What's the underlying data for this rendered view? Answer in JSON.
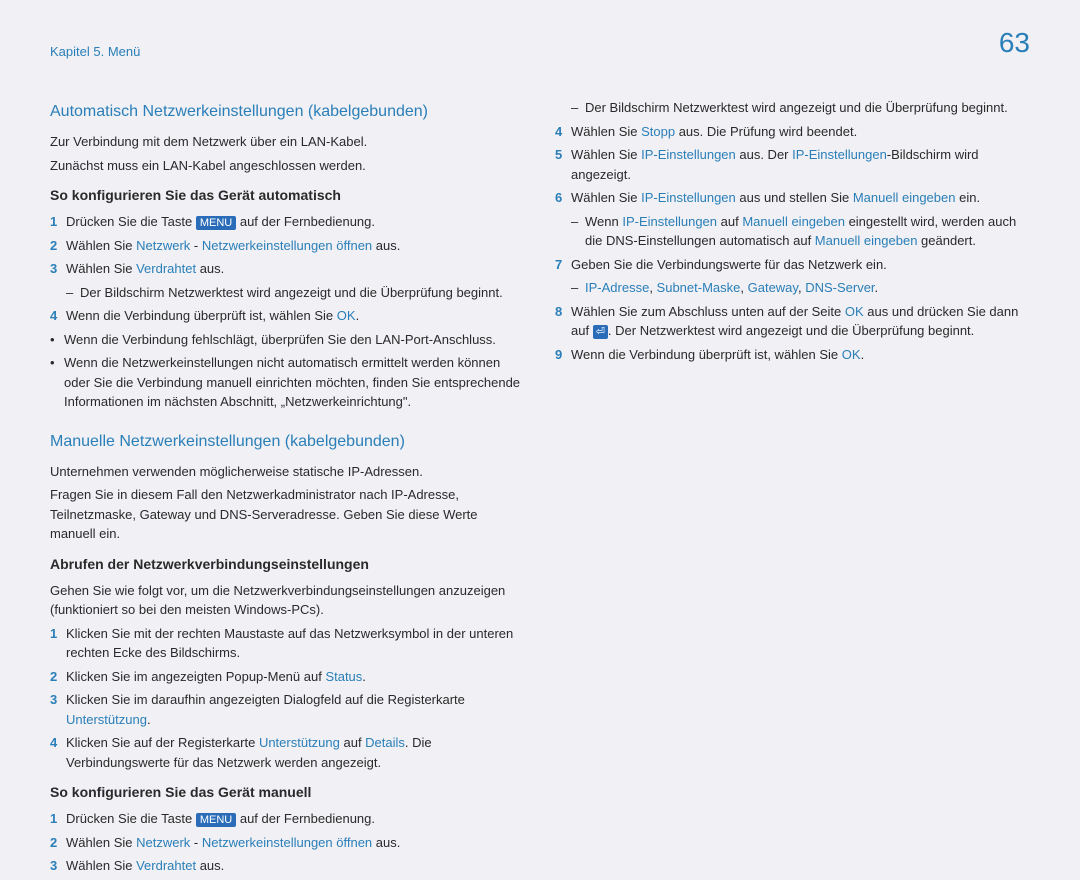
{
  "header": {
    "breadcrumb": "Kapitel 5. Menü",
    "page_number": "63"
  },
  "left": {
    "section1": {
      "title": "Automatisch Netzwerkeinstellungen (kabelgebunden)",
      "p1": "Zur Verbindung mit dem Netzwerk über ein LAN-Kabel.",
      "p2": "Zunächst muss ein LAN-Kabel angeschlossen werden.",
      "sub_title": "So konfigurieren Sie das Gerät automatisch",
      "step1_a": "Drücken Sie die Taste ",
      "step1_menu": "MENU",
      "step1_b": " auf der Fernbedienung.",
      "step2_a": "Wählen Sie ",
      "step2_hl1": "Netzwerk",
      "step2_mid": " - ",
      "step2_hl2": "Netzwerkeinstellungen öffnen",
      "step2_b": " aus.",
      "step3_a": "Wählen Sie ",
      "step3_hl": "Verdrahtet",
      "step3_b": " aus.",
      "step3_sub": "Der Bildschirm Netzwerktest wird angezeigt und die Überprüfung beginnt.",
      "step4_a": "Wenn die Verbindung überprüft ist, wählen Sie ",
      "step4_hl": "OK",
      "step4_b": ".",
      "bullet1": "Wenn die Verbindung fehlschlägt, überprüfen Sie den LAN-Port-Anschluss.",
      "bullet2": "Wenn die Netzwerkeinstellungen nicht automatisch ermittelt werden können oder Sie die Verbindung manuell einrichten möchten, finden Sie entsprechende Informationen im nächsten Abschnitt, „Netzwerkeinrichtung\"."
    },
    "section2": {
      "title": "Manuelle Netzwerkeinstellungen (kabelgebunden)",
      "p1": "Unternehmen verwenden möglicherweise statische IP-Adressen.",
      "p2": "Fragen Sie in diesem Fall den Netzwerkadministrator nach IP-Adresse, Teilnetzmaske, Gateway und DNS-Serveradresse. Geben Sie diese Werte manuell ein.",
      "sub_title1": "Abrufen der Netzwerkverbindungseinstellungen",
      "p3": "Gehen Sie wie folgt vor, um die Netzwerkverbindungseinstellungen anzuzeigen (funktioniert so bei den meisten Windows-PCs).",
      "a_step1": "Klicken Sie mit der rechten Maustaste auf das Netzwerksymbol in der unteren rechten Ecke des Bildschirms.",
      "a_step2_a": "Klicken Sie im angezeigten Popup-Menü auf ",
      "a_step2_hl": "Status",
      "a_step2_b": ".",
      "a_step3_a": "Klicken Sie im daraufhin angezeigten Dialogfeld auf die Registerkarte ",
      "a_step3_hl": "Unterstützung",
      "a_step3_b": ".",
      "a_step4_a": "Klicken Sie auf der Registerkarte ",
      "a_step4_hl1": "Unterstützung",
      "a_step4_mid": " auf ",
      "a_step4_hl2": "Details",
      "a_step4_b": ". Die Verbindungswerte für das Netzwerk werden angezeigt.",
      "sub_title2": "So konfigurieren Sie das Gerät manuell",
      "b_step1_a": "Drücken Sie die Taste ",
      "b_step1_menu": "MENU",
      "b_step1_b": " auf der Fernbedienung.",
      "b_step2_a": "Wählen Sie ",
      "b_step2_hl1": "Netzwerk",
      "b_step2_mid": " - ",
      "b_step2_hl2": "Netzwerkeinstellungen öffnen",
      "b_step2_b": " aus.",
      "b_step3_a": "Wählen Sie ",
      "b_step3_hl": "Verdrahtet",
      "b_step3_b": " aus."
    }
  },
  "right": {
    "sub1": "Der Bildschirm Netzwerktest wird angezeigt und die Überprüfung beginnt.",
    "step4_a": "Wählen Sie ",
    "step4_hl": "Stopp",
    "step4_b": " aus. Die Prüfung wird beendet.",
    "step5_a": "Wählen Sie ",
    "step5_hl1": "IP-Einstellungen",
    "step5_mid": " aus. Der ",
    "step5_hl2": "IP-Einstellungen",
    "step5_b": "-Bildschirm wird angezeigt.",
    "step6_a": "Wählen Sie ",
    "step6_hl1": "IP-Einstellungen",
    "step6_mid": " aus und stellen Sie ",
    "step6_hl2": "Manuell eingeben",
    "step6_b": " ein.",
    "step6_sub_a": "Wenn ",
    "step6_sub_hl1": "IP-Einstellungen",
    "step6_sub_mid1": " auf ",
    "step6_sub_hl2": "Manuell eingeben",
    "step6_sub_mid2": " eingestellt wird, werden auch die DNS-Einstellungen automatisch auf ",
    "step6_sub_hl3": "Manuell eingeben",
    "step6_sub_b": " geändert.",
    "step7": "Geben Sie die Verbindungswerte für das Netzwerk ein.",
    "step7_sub_a": "IP-Adresse",
    "step7_sub_sep": ", ",
    "step7_sub_b": "Subnet-Maske",
    "step7_sub_c": "Gateway",
    "step7_sub_d": "DNS-Server",
    "step7_sub_dot": ".",
    "step8_a": "Wählen Sie zum Abschluss unten auf der Seite ",
    "step8_hl": "OK",
    "step8_mid": " aus und drücken Sie dann auf ",
    "step8_icon": "⏎",
    "step8_b": ". Der Netzwerktest wird angezeigt und die Überprüfung beginnt.",
    "step9_a": "Wenn die Verbindung überprüft ist, wählen Sie ",
    "step9_hl": "OK",
    "step9_b": "."
  }
}
